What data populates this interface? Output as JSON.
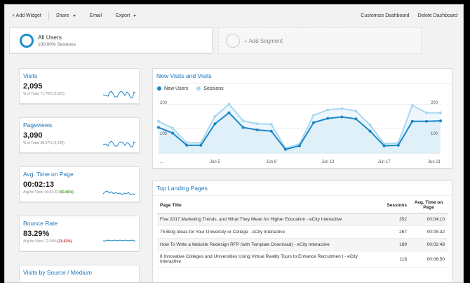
{
  "toolbar": {
    "add_widget": "+ Add Widget",
    "share": "Share",
    "email": "Email",
    "export": "Export",
    "customize": "Customize Dashboard",
    "delete": "Delete Dashboard"
  },
  "segments": {
    "active_title": "All Users",
    "active_sub": "100.00% Sessions",
    "add_label": "+ Add Segment"
  },
  "metrics": [
    {
      "title": "Visits",
      "value": "2,095",
      "sub_prefix": "% of Total: 71.70% (2,922)",
      "sub_pct": ""
    },
    {
      "title": "Pageviews",
      "value": "3,090",
      "sub_prefix": "% of Total: 88.97% (5,249)",
      "sub_pct": ""
    },
    {
      "title": "Avg. Time on Page",
      "value": "00:02:13",
      "sub_prefix": "Avg for View: 00:01:23 ",
      "sub_pct": "(60.46%)"
    },
    {
      "title": "Bounce Rate",
      "value": "83.29%",
      "sub_prefix": "Avg for View: 72.04% ",
      "sub_pct": "(15.62%)"
    }
  ],
  "visits_by_source": {
    "title": "Visits by Source / Medium"
  },
  "chart_card": {
    "title": "New Visits and Visits",
    "legend_new": "New Users",
    "legend_sessions": "Sessions",
    "y_top_left": "200",
    "y_mid_left": "100",
    "y_top_right": "200",
    "y_mid_right": "100",
    "x_start": "...",
    "x_labels": [
      "Jun 5",
      "Jun 9",
      "Jun 13",
      "Jun 17",
      "Jun 21"
    ]
  },
  "chart_data": {
    "type": "line",
    "title": "New Visits and Visits",
    "xlabel": "",
    "ylabel": "",
    "ylim": [
      0,
      230
    ],
    "grid": true,
    "legend_position": "top-left",
    "x": [
      "Jun 1",
      "Jun 2",
      "Jun 3",
      "Jun 4",
      "Jun 5",
      "Jun 6",
      "Jun 7",
      "Jun 8",
      "Jun 9",
      "Jun 10",
      "Jun 11",
      "Jun 12",
      "Jun 13",
      "Jun 14",
      "Jun 15",
      "Jun 16",
      "Jun 17",
      "Jun 18",
      "Jun 19",
      "Jun 20",
      "Jun 21"
    ],
    "series": [
      {
        "name": "Sessions",
        "color": "#a8d8f0",
        "values": [
          130,
          102,
          42,
          42,
          150,
          200,
          132,
          120,
          118,
          20,
          38,
          155,
          177,
          182,
          172,
          115,
          38,
          42,
          195,
          165,
          165
        ]
      },
      {
        "name": "New Users",
        "color": "#1a86c8",
        "values": [
          105,
          82,
          32,
          32,
          120,
          165,
          105,
          95,
          90,
          15,
          30,
          125,
          142,
          148,
          140,
          90,
          30,
          32,
          130,
          130,
          132
        ]
      }
    ]
  },
  "landing": {
    "title": "Top Landing Pages",
    "headers": [
      "Page Title",
      "Sessions",
      "Avg. Time on Page"
    ],
    "rows": [
      [
        "Five 2017 Marketing Trends, and What They Mean for Higher Education - eCity Interactive",
        "352",
        "00:04:10"
      ],
      [
        "75 Blog Ideas for Your University or College - eCity Interactive",
        "267",
        "00:05:32"
      ],
      [
        "How To Write a Website Redesign RFP (with Template Download) - eCity Interactive",
        "189",
        "00:02:48"
      ],
      [
        "6 Innovative Colleges and Universities Using Virtual Reality Tours to Enhance Recruitmen t - eCity Interactive",
        "118",
        "00:06:50"
      ]
    ]
  },
  "colors": {
    "accent": "#1a73b8",
    "new_users": "#1a86c8",
    "sessions": "#a8d8f0",
    "positive": "#4a9b2c"
  }
}
